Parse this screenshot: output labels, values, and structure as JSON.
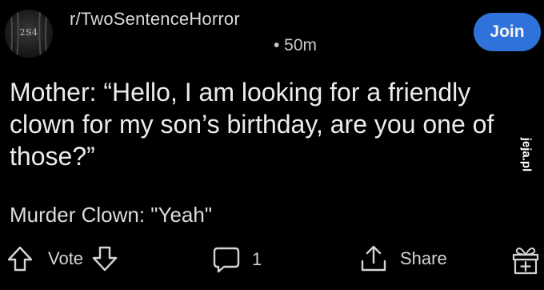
{
  "post": {
    "avatar_text": "2S4",
    "subreddit": "r/TwoSentenceHorror",
    "time": "• 50m",
    "join_label": "Join",
    "title": "Mother: “Hello, I am looking for a friendly clown for my son’s birthday, are you one of those?”",
    "body": "Murder Clown: \"Yeah\""
  },
  "actions": {
    "vote_label": "Vote",
    "comment_count": "1",
    "share_label": "Share"
  },
  "watermark": {
    "text": "jeja.pl"
  },
  "colors": {
    "background": "#000000",
    "join_button": "#2f72d9",
    "text": "#e8e8e8"
  },
  "icons": [
    "upvote-icon",
    "downvote-icon",
    "comment-icon",
    "share-icon",
    "award-icon"
  ]
}
